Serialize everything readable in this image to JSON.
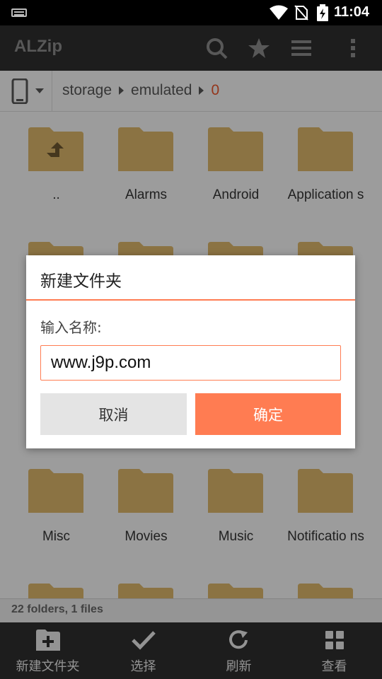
{
  "status_bar": {
    "time": "11:04"
  },
  "toolbar": {
    "title": "ALZip",
    "icons": [
      "search-icon",
      "star-icon",
      "menu-icon",
      "overflow-icon"
    ]
  },
  "path": {
    "crumbs": [
      "storage",
      "emulated",
      "0"
    ]
  },
  "folders": [
    {
      "name": ".."
    },
    {
      "name": "Alarms"
    },
    {
      "name": "Android"
    },
    {
      "name": "Application s"
    },
    {
      "name": ""
    },
    {
      "name": ""
    },
    {
      "name": ""
    },
    {
      "name": ""
    },
    {
      "name": "Misc"
    },
    {
      "name": "Movies"
    },
    {
      "name": "Music"
    },
    {
      "name": "Notificatio ns"
    }
  ],
  "footer": {
    "summary": "22 folders, 1 files"
  },
  "bottom_bar": {
    "new_folder": "新建文件夹",
    "select": "选择",
    "refresh": "刷新",
    "view": "查看"
  },
  "dialog": {
    "title": "新建文件夹",
    "prompt": "输入名称:",
    "input_value": "www.j9p.com",
    "cancel": "取消",
    "ok": "确定"
  },
  "colors": {
    "accent": "#ff7c52",
    "toolbar": "#2e2e2e",
    "folder": "#d9b56a",
    "active_crumb": "#e8552c"
  }
}
